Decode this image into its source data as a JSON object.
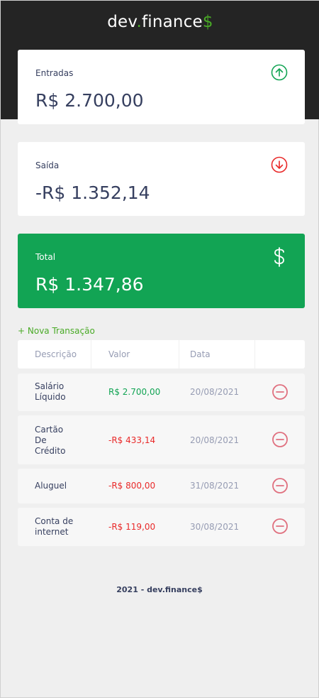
{
  "header": {
    "logo_prefix": "dev",
    "logo_dot": ".",
    "logo_name": "finance",
    "logo_suffix": "$",
    "accent_color": "#49aa26"
  },
  "balance": {
    "income": {
      "label": "Entradas",
      "amount": "R$ 2.700,00",
      "icon": "arrow-up-circle-icon"
    },
    "expense": {
      "label": "Saída",
      "amount": "-R$ 1.352,14",
      "icon": "arrow-down-circle-icon"
    },
    "total": {
      "label": "Total",
      "amount": "R$ 1.347,86",
      "icon": "dollar-sign-icon",
      "color": "#12a454"
    }
  },
  "actions": {
    "new_transaction": "+ Nova Transação"
  },
  "table": {
    "headers": [
      "Descrição",
      "Valor",
      "Data"
    ],
    "rows": [
      {
        "description": [
          "Salário",
          "Líquido"
        ],
        "amount": "R$ 2.700,00",
        "type": "income",
        "date": "20/08/2021"
      },
      {
        "description": [
          "Cartão",
          "De",
          "Crédito"
        ],
        "amount": "-R$ 433,14",
        "type": "expense",
        "date": "20/08/2021"
      },
      {
        "description": [
          "Aluguel"
        ],
        "amount": "-R$ 800,00",
        "type": "expense",
        "date": "31/08/2021"
      },
      {
        "description": [
          "Conta de",
          "internet"
        ],
        "amount": "-R$ 119,00",
        "type": "expense",
        "date": "30/08/2021"
      }
    ],
    "remove_icon": "minus-circle-icon"
  },
  "footer": {
    "text": "2021 - dev.finance$"
  },
  "colors": {
    "income": "#12a454",
    "expense": "#e92929",
    "dark": "#363f5f",
    "header_bg": "#242424"
  }
}
